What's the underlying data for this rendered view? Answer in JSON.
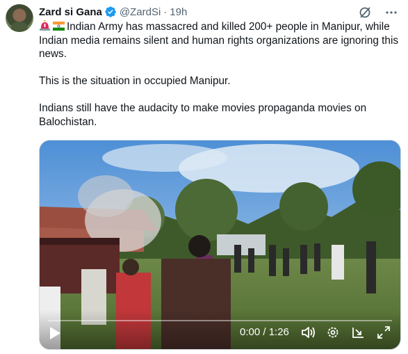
{
  "tweet": {
    "author_name": "Zard si Gana",
    "handle": "@ZardSi",
    "separator": "·",
    "time": "19h",
    "text_line1": "Indian Army has massacred and killed 200+ people in Manipur, while Indian media remains silent and human rights organizations are ignoring this news.",
    "text_line2": "This is the situation in occupied Manipur.",
    "text_line3": "Indians still have the audacity to make movies propaganda movies on Balochistan.",
    "icons": [
      "avatar",
      "verified-badge-icon",
      "grok-icon",
      "more-icon",
      "siren-emoji-icon",
      "india-flag-icon"
    ]
  },
  "video": {
    "timecode": "0:00 / 1:26",
    "progress": 0,
    "icons": [
      "play-icon",
      "volume-icon",
      "settings-gear-icon",
      "dock-icon",
      "fullscreen-icon"
    ]
  },
  "colors": {
    "verified": "#1d9bf0",
    "text": "#0f1419",
    "secondary": "#536471"
  }
}
